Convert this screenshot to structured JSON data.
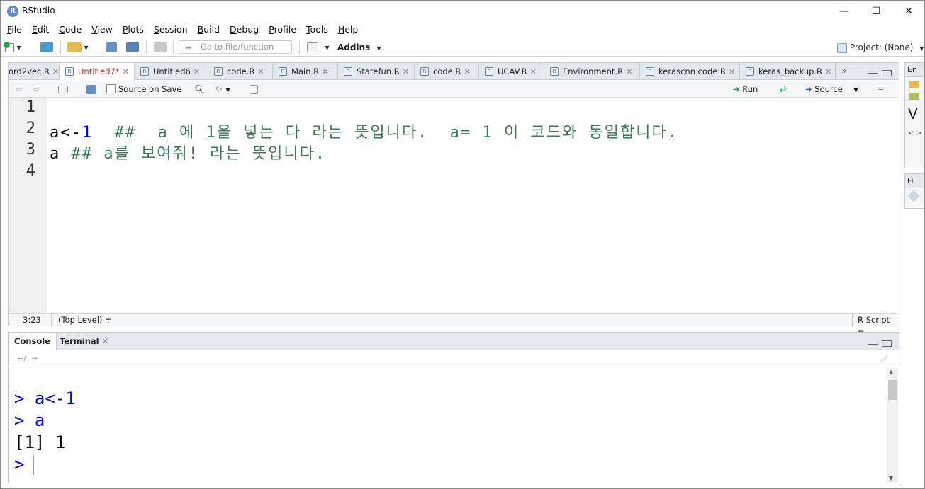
{
  "window": {
    "title": "RStudio",
    "controls": [
      "—",
      "☐",
      "✕"
    ]
  },
  "menu": [
    "File",
    "Edit",
    "Code",
    "View",
    "Plots",
    "Session",
    "Build",
    "Debug",
    "Profile",
    "Tools",
    "Help"
  ],
  "toolbar": {
    "goto_placeholder": "Go to file/function",
    "addins_label": "Addins",
    "project_label": "Project: (None)"
  },
  "editor": {
    "tabs": [
      {
        "label": "ord2vec.R",
        "active": false
      },
      {
        "label": "Untitled7*",
        "active": true
      },
      {
        "label": "Untitled6",
        "active": false
      },
      {
        "label": "code.R",
        "active": false
      },
      {
        "label": "Main.R",
        "active": false
      },
      {
        "label": "Statefun.R",
        "active": false
      },
      {
        "label": "code.R",
        "active": false
      },
      {
        "label": "UCAV.R",
        "active": false
      },
      {
        "label": "Environment.R",
        "active": false
      },
      {
        "label": "kerascnn code.R",
        "active": false
      },
      {
        "label": "keras_backup.R",
        "active": false
      }
    ],
    "source_on_save_label": "Source on Save",
    "run_label": "Run",
    "source_label": "Source",
    "line_numbers": [
      "1",
      "2",
      "3",
      "4"
    ],
    "lines": [
      {
        "id": "",
        "op": "",
        "num": "",
        "comment": ""
      },
      {
        "id": "a",
        "op": "<-",
        "num": "1",
        "comment": "  ##  a 에 1을 넣는 다 라는 뜻입니다.  a= 1 이 코드와 동일합니다."
      },
      {
        "id": "a",
        "op": "",
        "num": "",
        "comment": " ## a를 보여줘! 라는 뜻입니다."
      },
      {
        "id": "",
        "op": "",
        "num": "",
        "comment": ""
      }
    ],
    "status": {
      "position": "3:23",
      "scope": "(Top Level) ≑",
      "filetype": "R Script ≑"
    }
  },
  "console": {
    "tabs": [
      "Console",
      "Terminal"
    ],
    "path": "~/",
    "lines": [
      {
        "prompt": ">",
        "text": "a<-1",
        "kind": "cmd"
      },
      {
        "prompt": ">",
        "text": "a",
        "kind": "cmd"
      },
      {
        "prompt": "",
        "text": "[1] 1",
        "kind": "out"
      },
      {
        "prompt": ">",
        "text": "",
        "kind": "cmd"
      }
    ]
  },
  "right_panel": {
    "labels": [
      "En",
      "V",
      "< >",
      "Fi"
    ]
  }
}
